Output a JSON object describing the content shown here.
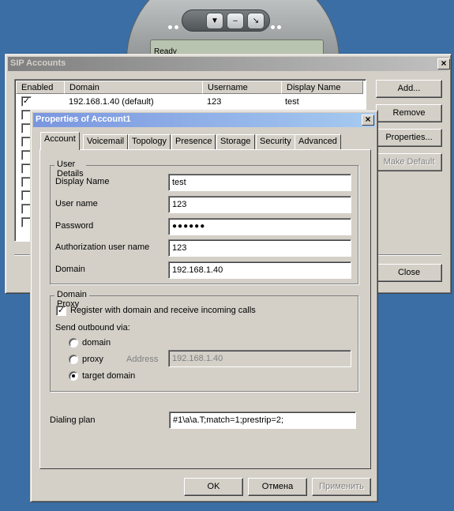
{
  "phone": {
    "screen_text": "Ready"
  },
  "sip_window": {
    "title": "SIP Accounts",
    "columns": [
      "Enabled",
      "Domain",
      "Username",
      "Display Name"
    ],
    "rows": [
      {
        "enabled": true,
        "domain": "192.168.1.40 (default)",
        "username": "123",
        "display_name": "test"
      }
    ],
    "buttons": {
      "add": "Add...",
      "remove": "Remove",
      "properties": "Properties...",
      "make_default": "Make Default",
      "close": "Close"
    }
  },
  "props_dialog": {
    "title": "Properties of Account1",
    "tabs": [
      "Account",
      "Voicemail",
      "Topology",
      "Presence",
      "Storage",
      "Security",
      "Advanced"
    ],
    "active_tab": "Account",
    "user_details": {
      "group_label": "User Details",
      "display_name_label": "Display Name",
      "display_name": "test",
      "user_name_label": "User name",
      "user_name": "123",
      "password_label": "Password",
      "password": "●●●●●●",
      "auth_user_label": "Authorization user name",
      "auth_user": "123",
      "domain_label": "Domain",
      "domain": "192.168.1.40"
    },
    "domain_proxy": {
      "group_label": "Domain Proxy",
      "register_label": "Register with domain and receive incoming calls",
      "register_checked": true,
      "send_outbound_label": "Send outbound via:",
      "options": [
        "domain",
        "proxy",
        "target domain"
      ],
      "selected": "target domain",
      "address_label": "Address",
      "address_value": "192.168.1.40"
    },
    "dialing_plan_label": "Dialing plan",
    "dialing_plan": "#1\\a\\a.T;match=1;prestrip=2;",
    "buttons": {
      "ok": "OK",
      "cancel": "Отмена",
      "apply": "Применить"
    }
  }
}
